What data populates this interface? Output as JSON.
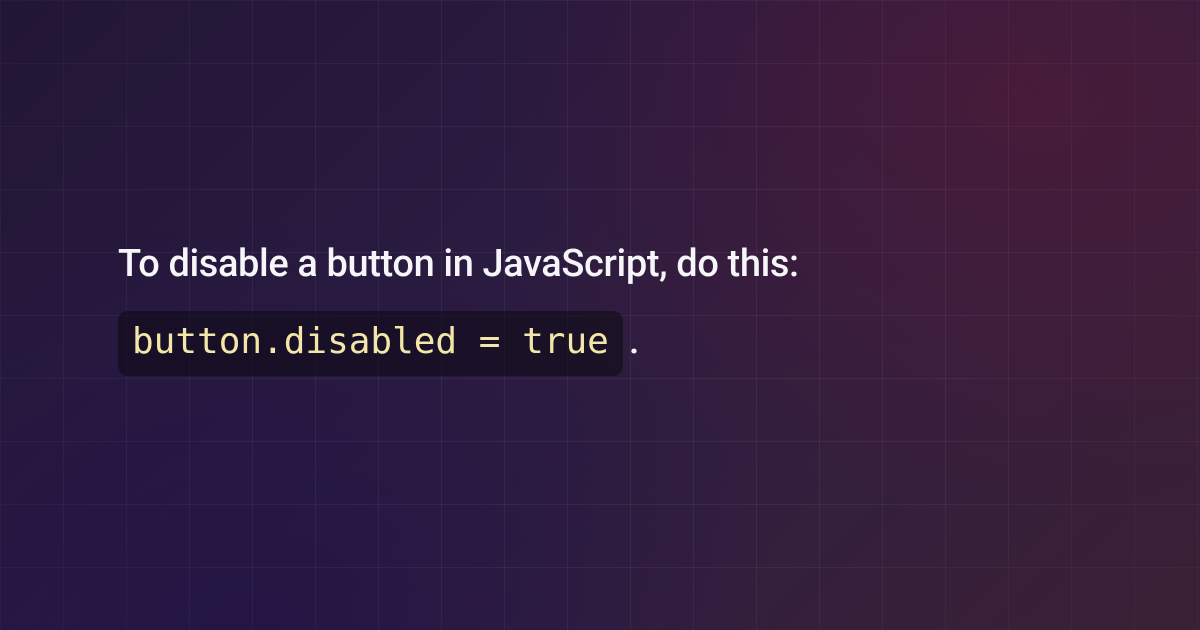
{
  "heading": "To disable a button in JavaScript, do this:",
  "code": "button.disabled = true",
  "trailing": "."
}
